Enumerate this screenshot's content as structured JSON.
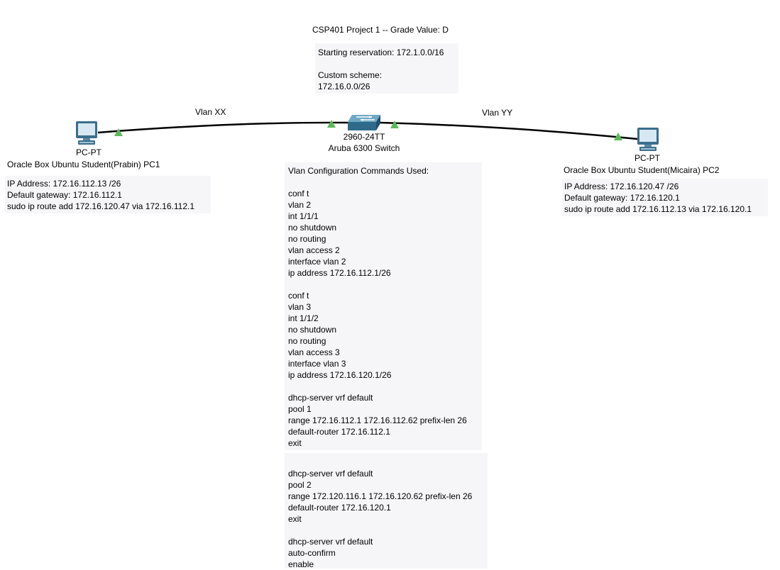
{
  "title": "CSP401 Project 1 -- Grade Value:  D",
  "reservation": {
    "starting": "Starting reservation:  172.1.0.0/16",
    "scheme_label": "Custom scheme:",
    "scheme_value": "172.16.0.0/26"
  },
  "links": {
    "left_label": "Vlan XX",
    "right_label": "Vlan YY",
    "link_color": "#000000",
    "port_color": "#5bb85b"
  },
  "switch": {
    "model": "2960-24TT",
    "name": "Aruba 6300 Switch",
    "icon": "switch-icon"
  },
  "pc1": {
    "type": "PC-PT",
    "name": "Oracle Box Ubuntu Student(Prabin) PC1",
    "icon": "pc-icon",
    "lines": [
      "IP Address:  172.16.112.13 /26",
      "Default gateway:  172.16.112.1",
      "sudo ip route add 172.16.120.47 via 172.16.112.1"
    ]
  },
  "pc2": {
    "type": "PC-PT",
    "name": "Oracle Box Ubuntu Student(Micaira) PC2",
    "icon": "pc-icon",
    "lines": [
      "IP Address:  172.16.120.47 /26",
      "Default gateway:  172.16.120.1",
      "sudo ip route add 172.16.112.13 via 172.16.120.1"
    ]
  },
  "config": {
    "heading": "Vlan Configuration Commands Used:",
    "block_vlan2": [
      "conf t",
      "vlan 2",
      "int 1/1/1",
      "no shutdown",
      "no routing",
      "vlan access 2",
      "interface vlan 2",
      "ip address 172.16.112.1/26"
    ],
    "block_vlan3": [
      "conf t",
      "vlan 3",
      "int 1/1/2",
      "no shutdown",
      "no routing",
      "vlan access 3",
      "interface vlan 3",
      "ip address 172.16.120.1/26"
    ],
    "block_pool1": [
      "dhcp-server vrf default",
      "pool 1",
      "range 172.16.112.1 172.16.112.62 prefix-len 26",
      "default-router 172.16.112.1",
      "exit"
    ]
  },
  "config2": {
    "block_pool2": [
      "dhcp-server vrf default",
      "pool 2",
      "range 172.120.116.1 172.16.120.62 prefix-len 26",
      "default-router 172.16.120.1",
      "exit"
    ],
    "block_enable": [
      "dhcp-server vrf default",
      "auto-confirm",
      "enable"
    ]
  }
}
